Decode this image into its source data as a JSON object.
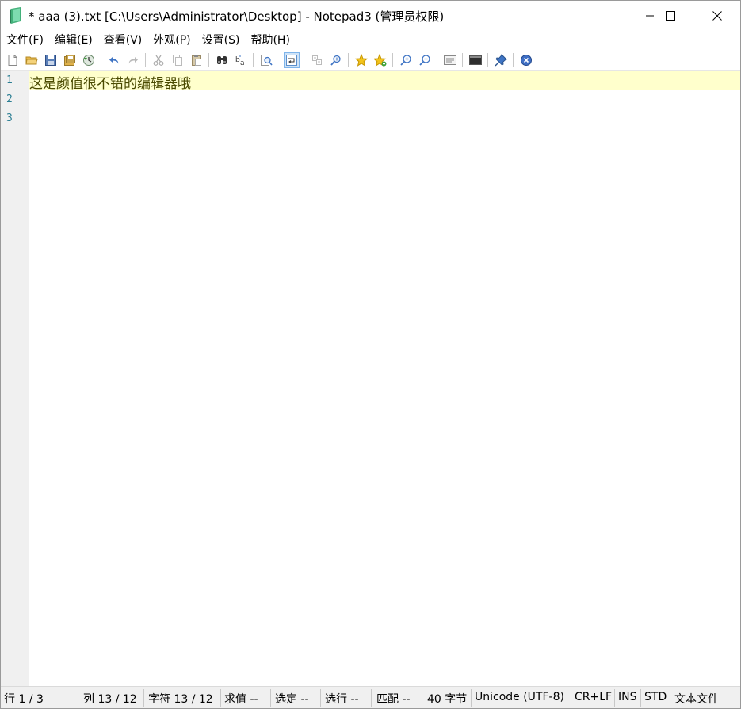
{
  "window": {
    "title": "* aaa (3).txt [C:\\Users\\Administrator\\Desktop] - Notepad3   (管理员权限)"
  },
  "menu": {
    "items": [
      "文件(F)",
      "编辑(E)",
      "查看(V)",
      "外观(P)",
      "设置(S)",
      "帮助(H)"
    ]
  },
  "toolbar": {
    "icons": [
      "new-file-icon",
      "open-folder-icon",
      "save-icon",
      "save-as-icon",
      "revert-icon",
      "undo-icon",
      "redo-icon",
      "cut-icon",
      "copy-icon",
      "paste-icon",
      "find-icon",
      "replace-icon",
      "preview-icon",
      "word-wrap-icon",
      "view-whitespace-icon",
      "find-in-files-icon",
      "bookmark-star-icon",
      "add-bookmark-icon",
      "zoom-in-icon",
      "zoom-out-icon",
      "schemes-icon",
      "console-icon",
      "pin-icon",
      "exit-icon"
    ]
  },
  "editor": {
    "line_numbers": [
      "1",
      "2",
      "3"
    ],
    "lines": [
      "这是颜值很不错的编辑器哦",
      "",
      ""
    ]
  },
  "statusbar": {
    "line": "行  1 / 3",
    "column": "列  13 / 12",
    "chars": "字符  13 / 12",
    "eval": "求值  --",
    "selection": "选定  --",
    "selected_lines": "选行  --",
    "matches": "匹配  --",
    "bytes": "40 字节",
    "encoding": "Unicode (UTF-8)",
    "eol": "CR+LF",
    "ovr": "INS",
    "mode": "STD",
    "lexer": "文本文件"
  },
  "colors": {
    "current_line_bg": "#ffffcc",
    "gutter_bg": "#f0f0f0",
    "line_number": "#2b7e93",
    "text": "#4a4a00"
  }
}
